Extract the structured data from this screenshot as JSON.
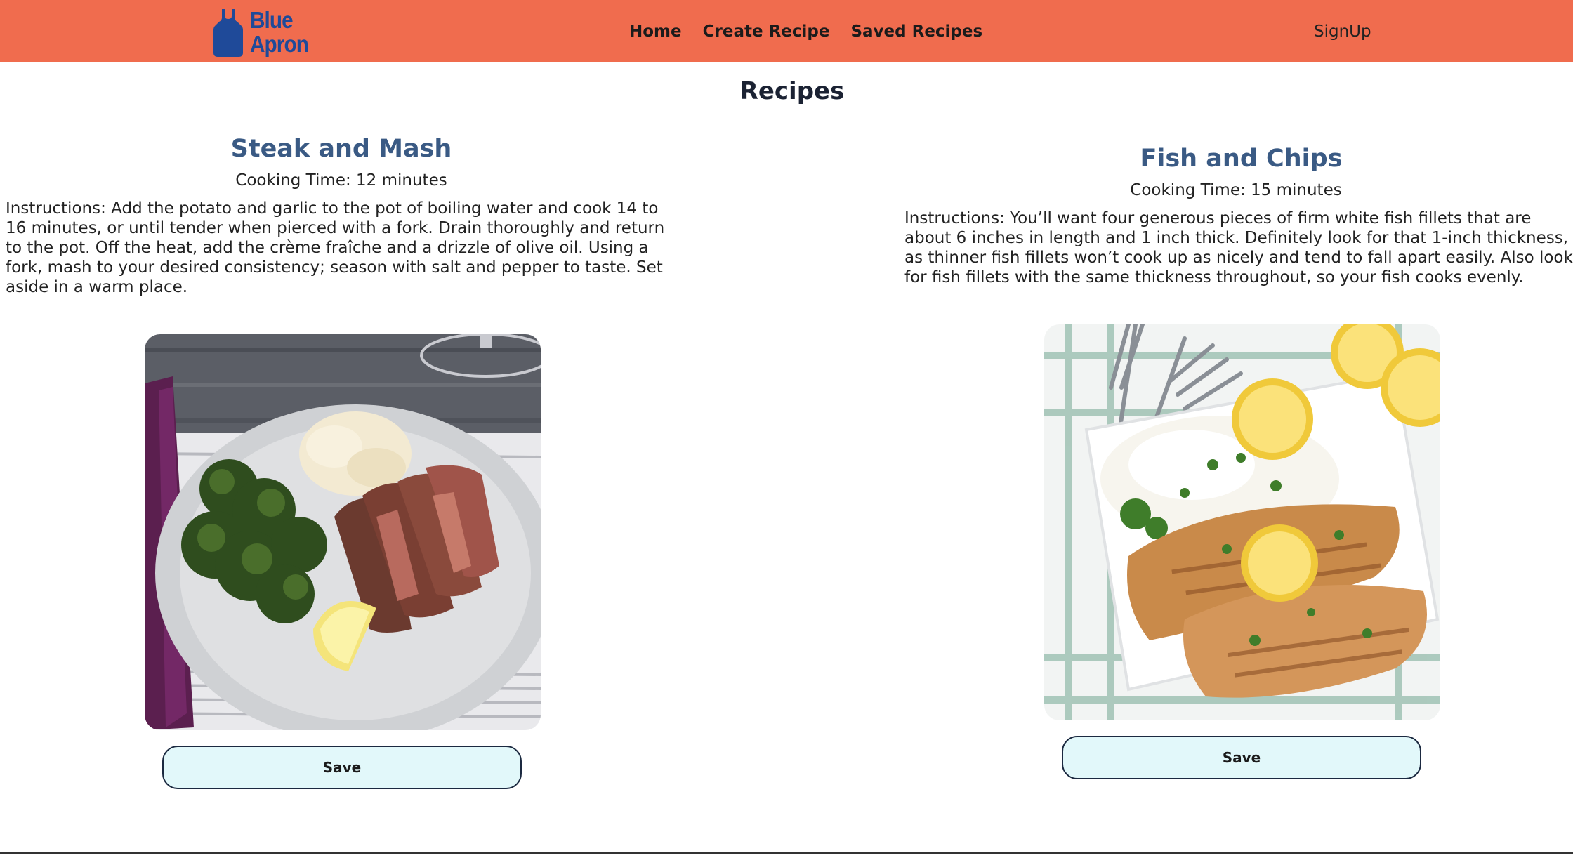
{
  "brand": {
    "line1": "Blue",
    "line2": "Apron",
    "color": "#1f4a99"
  },
  "nav": {
    "links": [
      "Home",
      "Create Recipe",
      "Saved Recipes"
    ],
    "signup": "SignUp",
    "background": "#f06c4e"
  },
  "page": {
    "title": "Recipes"
  },
  "recipes": [
    {
      "name": "Steak and Mash",
      "cooking_time": "Cooking Time: 12 minutes",
      "instructions": "Instructions: Add the potato and garlic to the pot of boiling water and cook 14 to 16 minutes, or until tender when pierced with a fork. Drain thoroughly and return to the pot. Off the heat, add the crème fraîche and a drizzle of olive oil. Using a fork, mash to your desired consistency; season with salt and pepper to taste. Set aside in a warm place.",
      "image_icon": "steak-plate-photo",
      "save_label": "Save"
    },
    {
      "name": "Fish and Chips",
      "cooking_time": "Cooking Time: 15 minutes",
      "instructions": "Instructions: You’ll want four generous pieces of firm white fish fillets that are about 6 inches in length and 1 inch thick. Definitely look for that 1-inch thickness, as thinner fish fillets won’t cook up as nicely and tend to fall apart easily. Also look for fish fillets with the same thickness throughout, so your fish cooks evenly.",
      "image_icon": "fish-rice-photo",
      "save_label": "Save"
    }
  ],
  "colors": {
    "recipe_title": "#3a5a84",
    "save_button_bg": "#e2f8fa"
  }
}
